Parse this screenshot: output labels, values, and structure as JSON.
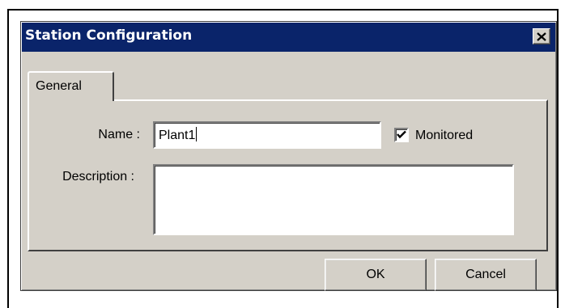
{
  "window": {
    "title": "Station Configuration",
    "close_label": "×"
  },
  "tabs": [
    {
      "label": "General",
      "active": true
    }
  ],
  "form": {
    "name_label": "Name :",
    "name_value": "Plant1",
    "monitored_label": "Monitored",
    "monitored_checked": true,
    "description_label": "Description :",
    "description_value": ""
  },
  "buttons": {
    "ok": "OK",
    "cancel": "Cancel"
  },
  "icons": {
    "close": "close-icon",
    "check": "checkmark-icon"
  },
  "colors": {
    "title_bar": "#0a246a",
    "dialog_face": "#d4d0c8"
  }
}
